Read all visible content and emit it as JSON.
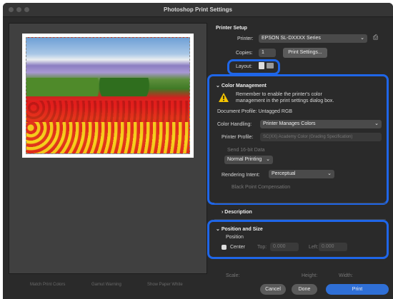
{
  "window": {
    "title": "Photoshop Print Settings"
  },
  "printer_setup": {
    "heading": "Printer Setup",
    "printer_label": "Printer:",
    "printer_value": "EPSON SL-DXXXX Series",
    "copies_label": "Copies:",
    "copies_value": "1",
    "print_settings_button": "Print Settings...",
    "layout_label": "Layout:"
  },
  "color_management": {
    "heading": "Color Management",
    "notice": "Remember to enable the printer's color management in the print settings dialog box.",
    "doc_profile": "Document Profile: Untagged RGB",
    "handling_label": "Color Handling:",
    "handling_value": "Printer Manages Colors",
    "profile_label": "Printer Profile:",
    "profile_value": "SC(XX) Academy Color (Grading Specification)",
    "send16": "Send 16-bit Data",
    "normal_printing": "Normal Printing",
    "rendering_label": "Rendering Intent:",
    "rendering_value": "Perceptual",
    "black_point": "Black Point Compensation"
  },
  "description": {
    "heading": "Description"
  },
  "position": {
    "heading": "Position and Size",
    "sub": "Position",
    "center_label": "Center",
    "top_label": "Top:",
    "top_value": "0.000",
    "left_label": "Left:",
    "left_value": "0.000"
  },
  "scale": {
    "scale_label": "Scale:",
    "height_label": "Height:",
    "width_label": "Width:"
  },
  "bottom_buttons": {
    "match": "Match Print Colors",
    "gamut": "Gamut Warning",
    "paper_white": "Show Paper White",
    "cancel": "Cancel",
    "done": "Done",
    "print": "Print"
  },
  "colors": {
    "accent": "#1f66e8",
    "print_button": "#2f6fd6",
    "warning": "#f4c400"
  },
  "icons": [
    "portrait-layout-icon",
    "landscape-layout-icon",
    "printer-options-icon",
    "warning-icon",
    "chevron-down-icon",
    "chevron-right-icon",
    "checkbox-icon"
  ]
}
